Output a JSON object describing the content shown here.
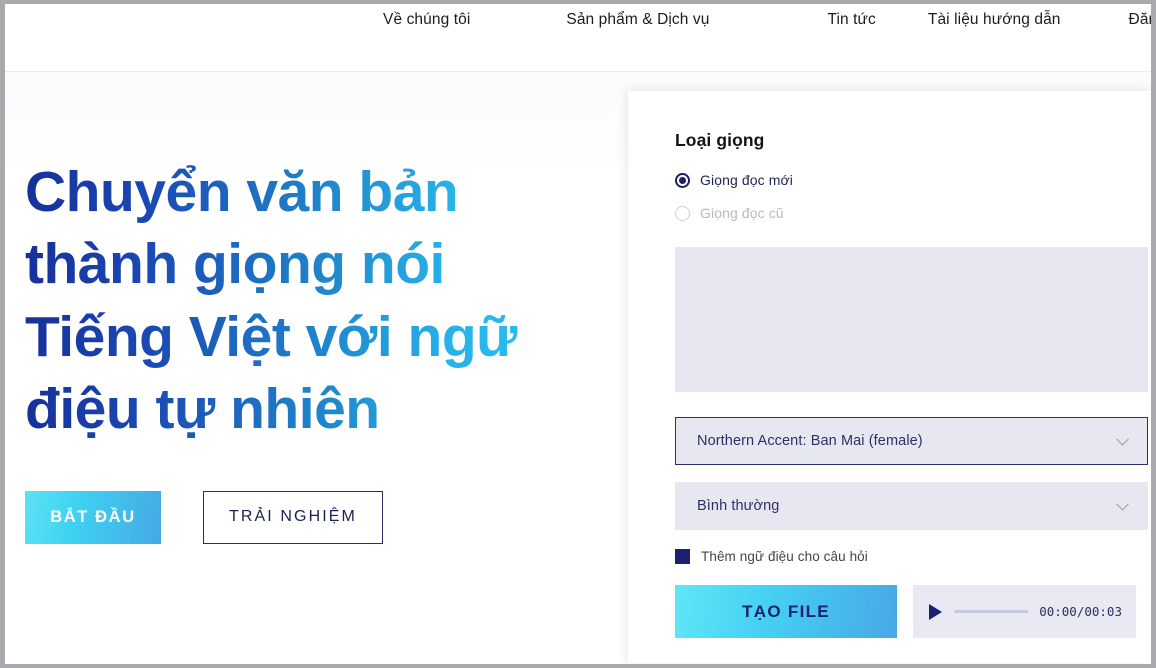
{
  "nav": {
    "items": [
      {
        "label": "Về chúng tôi",
        "name": "nav-about"
      },
      {
        "label": "Sản phẩm & Dịch vụ",
        "name": "nav-products-services"
      },
      {
        "label": "Tin tức",
        "name": "nav-news"
      },
      {
        "label": "Tài liệu hướng dẫn",
        "name": "nav-documentation"
      },
      {
        "label": "Đăng nhập",
        "name": "nav-login"
      }
    ]
  },
  "hero": {
    "title": "Chuyển văn bản thành giọng nói Tiếng Việt với ngữ điệu tự nhiên",
    "primary_button": "BẮT ĐẦU",
    "secondary_button": "TRẢI NGHIỆM",
    "gradient_start": "#17309a",
    "gradient_end": "#2ac7f3"
  },
  "panel": {
    "title": "Loại giọng",
    "radios": [
      {
        "label": "Giọng đọc mới",
        "selected": true,
        "disabled": false
      },
      {
        "label": "Giọng đọc cũ",
        "selected": false,
        "disabled": true
      }
    ],
    "textarea": {
      "value": "",
      "placeholder": ""
    },
    "voice_select": {
      "value": "Northern Accent: Ban Mai (female)",
      "focused": true,
      "icon": "chevron-down-icon"
    },
    "style_select": {
      "value": "Bình thường",
      "focused": false,
      "icon": "chevron-down-icon"
    },
    "checkbox": {
      "label": "Thêm ngữ điệu cho câu hỏi",
      "checked": true,
      "color": "#1b2170"
    },
    "generate_button": "TẠO FILE",
    "player": {
      "play_icon": "play-icon",
      "time": "00:00/00:03",
      "progress_percent": 0
    }
  },
  "colors": {
    "navy": "#1b2170",
    "cyan": "#2ac7f3",
    "field_bg": "#e6e7f1"
  }
}
